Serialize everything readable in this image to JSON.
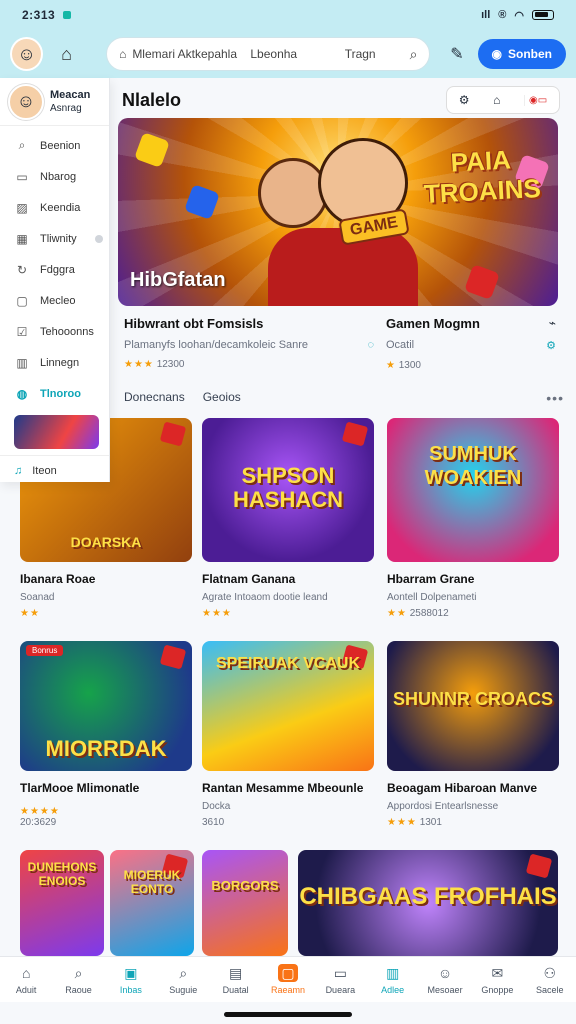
{
  "status": {
    "time": "2:313",
    "signal": "ıll",
    "alert": "®"
  },
  "header": {
    "search_placeholder": "Mlemari Aktkepahla",
    "search_category": "Lbeonha",
    "search_region": "Tragn",
    "signin_label": "Sonben"
  },
  "sidebar": {
    "user_name": "Meacan",
    "user_status": "Asnrag",
    "items": [
      {
        "label": "Beenion",
        "icon": "search-icon"
      },
      {
        "label": "Nbarog",
        "icon": "monitor-icon"
      },
      {
        "label": "Keendia",
        "icon": "image-icon"
      },
      {
        "label": "Tliwnity",
        "icon": "calendar-icon"
      },
      {
        "label": "Fdggra",
        "icon": "refresh-icon"
      },
      {
        "label": "Mecleo",
        "icon": "chat-icon"
      },
      {
        "label": "Tehooonns",
        "icon": "checkbox-icon"
      },
      {
        "label": "Linnegn",
        "icon": "chart-icon"
      },
      {
        "label": "Tlnoroo",
        "icon": "location-icon"
      }
    ],
    "footer_label": "Iteon"
  },
  "main": {
    "title": "Nlalelo",
    "hero": {
      "title": "HibGfatan",
      "logo_line1": "PAIA",
      "logo_line2": "TROAINS",
      "tag": "GAME"
    },
    "featured": [
      {
        "title": "Hibwrant obt Fomsisls",
        "subtitle": "Plamanyfs loohan/decamkoleic Sanre",
        "stars": "★★★",
        "rating": "12300"
      },
      {
        "title": "Gamen Mogmn",
        "subtitle": "Ocatil",
        "stars": "★",
        "rating": "1300"
      }
    ],
    "section_tabs": [
      "Donecnans",
      "Geoios"
    ],
    "more": "•••"
  },
  "games": [
    {
      "name": "Ibanara Roae",
      "sub": "Soanad",
      "stars": "★★",
      "rating": "",
      "logo": "DOARSKA"
    },
    {
      "name": "Flatnam Ganana",
      "sub": "Agrate Intoaom dootie leand",
      "stars": "★★★",
      "rating": "",
      "logo": "SHPSON HASHACN"
    },
    {
      "name": "Hbarram Grane",
      "sub": "Aontell Dolpenameti",
      "stars": "★★",
      "rating": "2588012",
      "logo": "SUMHUK WOAKIEN"
    },
    {
      "name": "TlarMooe Mlimonatle",
      "sub": "",
      "stars": "★★★★",
      "rating": "20:3629",
      "logo": "MIORRDAK",
      "tag": "Bonrus"
    },
    {
      "name": "Rantan Mesamme Mbeounle",
      "sub": "Docka",
      "stars": "",
      "rating": "3610",
      "logo": "SPEIRUAK VCAUK"
    },
    {
      "name": "Beoagam Hibaroan Manve",
      "sub": "Appordosi Entearlsnesse",
      "stars": "★★★",
      "rating": "1301",
      "logo": "SHUNNR CROACS"
    },
    {
      "name": "",
      "sub": "",
      "stars": "",
      "rating": "",
      "logo": "DUNEHONS ENOIOS"
    },
    {
      "name": "",
      "sub": "",
      "stars": "",
      "rating": "",
      "logo": "MIOERUK EONTO"
    },
    {
      "name": "",
      "sub": "",
      "stars": "",
      "rating": "",
      "logo": "BORGORS"
    },
    {
      "name": "",
      "sub": "",
      "stars": "",
      "rating": "",
      "logo": "CHIBGAAS FROFHAIS"
    }
  ],
  "bottom_nav": [
    {
      "label": "Aduit",
      "icon": "home-icon"
    },
    {
      "label": "Raoue",
      "icon": "search-icon"
    },
    {
      "label": "Inbas",
      "icon": "inbox-icon"
    },
    {
      "label": "Suguie",
      "icon": "search-icon"
    },
    {
      "label": "Duatal",
      "icon": "doc-icon"
    },
    {
      "label": "Raeamn",
      "icon": "game-icon"
    },
    {
      "label": "Dueara",
      "icon": "file-icon"
    },
    {
      "label": "Adlee",
      "icon": "chart-icon"
    },
    {
      "label": "Mesoaer",
      "icon": "users-icon"
    },
    {
      "label": "Gnoppe",
      "icon": "mail-icon"
    },
    {
      "label": "Sacele",
      "icon": "person-icon"
    }
  ]
}
